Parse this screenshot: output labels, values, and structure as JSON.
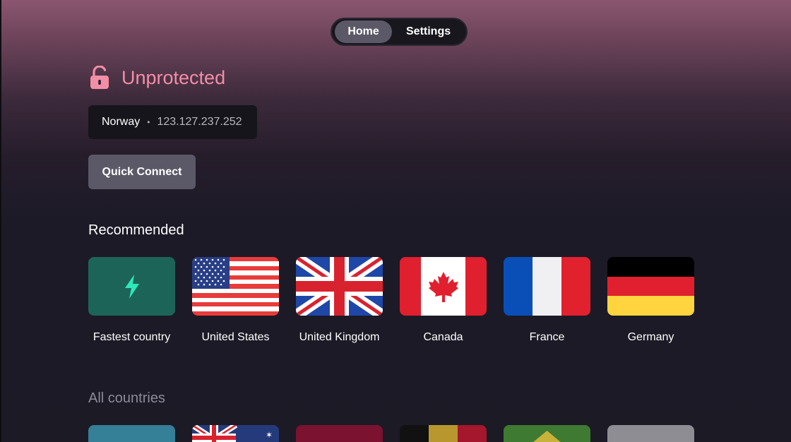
{
  "nav": {
    "tabs": [
      {
        "label": "Home",
        "active": true
      },
      {
        "label": "Settings",
        "active": false
      }
    ]
  },
  "status": {
    "text": "Unprotected",
    "icon": "unlocked-padlock-icon",
    "color": "#f28ea6"
  },
  "location": {
    "country": "Norway",
    "separator": "•",
    "ip": "123.127.237.252"
  },
  "quick_connect": {
    "label": "Quick Connect"
  },
  "recommended": {
    "title": "Recommended",
    "items": [
      {
        "label": "Fastest country",
        "icon": "lightning-bolt-icon"
      },
      {
        "label": "United States",
        "icon": "us-flag-icon"
      },
      {
        "label": "United Kingdom",
        "icon": "uk-flag-icon"
      },
      {
        "label": "Canada",
        "icon": "canada-flag-icon"
      },
      {
        "label": "France",
        "icon": "france-flag-icon"
      },
      {
        "label": "Germany",
        "icon": "germany-flag-icon"
      }
    ]
  },
  "all_countries": {
    "title": "All countries",
    "visible_tiles": [
      "teal-tile",
      "australia-flag-icon",
      "maroon-tile",
      "belgium-flag-icon",
      "brazil-flag-icon",
      "gray-tile"
    ]
  },
  "colors": {
    "accent_unprotected": "#f28ea6",
    "button": "#5b5867",
    "fastest_tile": "#1d6458",
    "bolt": "#2ee8b8"
  }
}
